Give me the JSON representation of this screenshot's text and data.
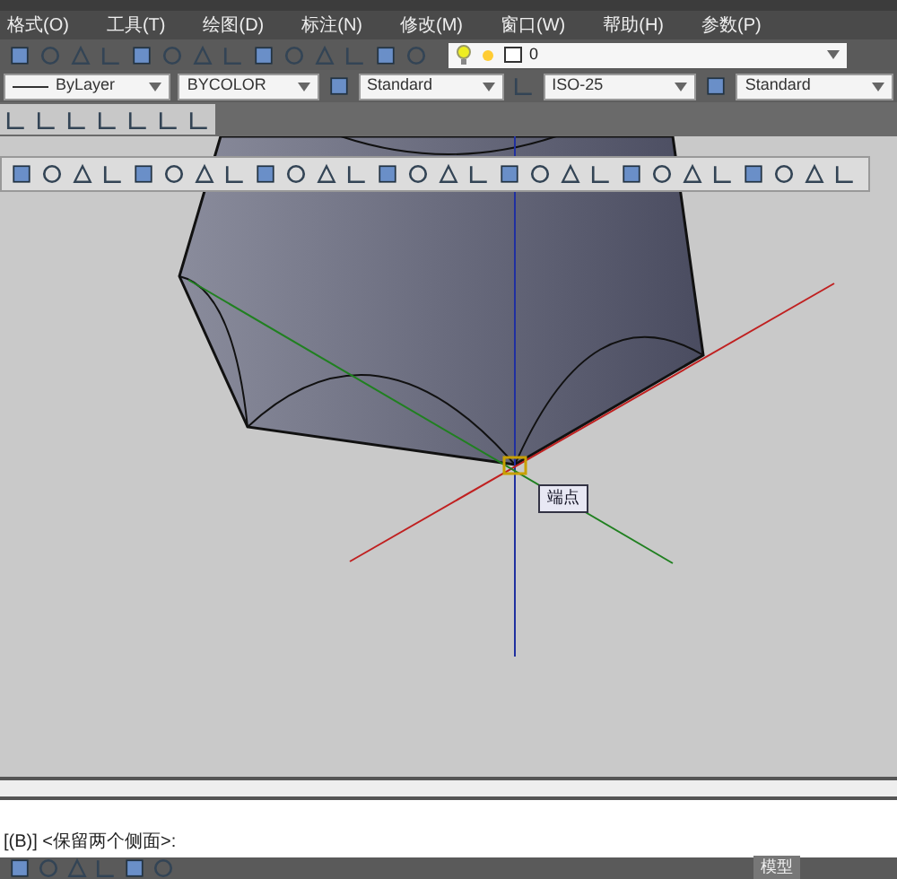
{
  "menu": [
    "格式(O)",
    "工具(T)",
    "绘图(D)",
    "标注(N)",
    "修改(M)",
    "窗口(W)",
    "帮助(H)",
    "参数(P)"
  ],
  "layer": {
    "value": "0"
  },
  "style_bar": [
    {
      "kind": "linetype",
      "value": "ByLayer"
    },
    {
      "kind": "plain",
      "value": "BYCOLOR"
    },
    {
      "kind": "text",
      "value": "Standard"
    },
    {
      "kind": "dim",
      "value": "ISO-25"
    },
    {
      "kind": "table",
      "value": "Standard"
    }
  ],
  "tooltip": "端点",
  "command_line": "[(B)] <保留两个侧面>:",
  "status_bar": {
    "model": "模型"
  }
}
